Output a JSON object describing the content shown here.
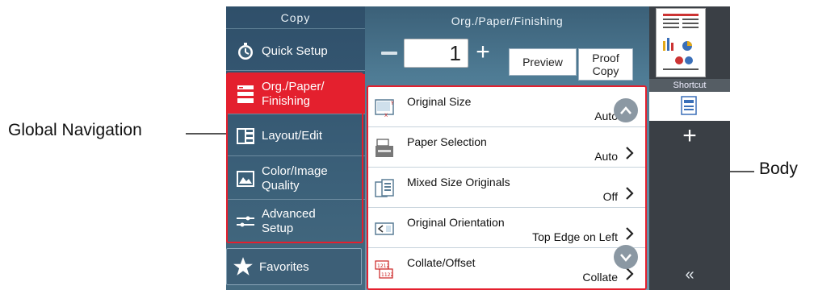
{
  "callouts": {
    "global_navigation": "Global Navigation",
    "body": "Body"
  },
  "nav": {
    "title": "Copy",
    "quick_setup": "Quick Setup",
    "items": [
      {
        "line1": "Org./Paper/",
        "line2": "Finishing",
        "icon": "org-paper-icon",
        "active": true
      },
      {
        "line1": "Layout/Edit",
        "line2": "",
        "icon": "layout-icon",
        "active": false
      },
      {
        "line1": "Color/Image",
        "line2": "Quality",
        "icon": "image-quality-icon",
        "active": false
      },
      {
        "line1": "Advanced",
        "line2": "Setup",
        "icon": "advanced-setup-icon",
        "active": false
      }
    ],
    "favorites": "Favorites"
  },
  "main": {
    "title": "Org./Paper/Finishing",
    "copies": "1",
    "preview": "Preview",
    "proof_line1": "Proof",
    "proof_line2": "Copy",
    "rows": [
      {
        "label": "Original Size",
        "value": "Auto",
        "icon": "original-size-icon"
      },
      {
        "label": "Paper Selection",
        "value": "Auto",
        "icon": "paper-selection-icon"
      },
      {
        "label": "Mixed Size Originals",
        "value": "Off",
        "icon": "mixed-size-icon"
      },
      {
        "label": "Original Orientation",
        "value": "Top Edge on Left",
        "icon": "orientation-icon"
      },
      {
        "label": "Collate/Offset",
        "value": "Collate",
        "icon": "collate-icon"
      }
    ]
  },
  "right": {
    "shortcut": "Shortcut",
    "collapse": "«"
  },
  "colors": {
    "accent_red": "#e4202e",
    "nav_blue": "#3b6079",
    "panel_dark": "#3a3f45"
  }
}
